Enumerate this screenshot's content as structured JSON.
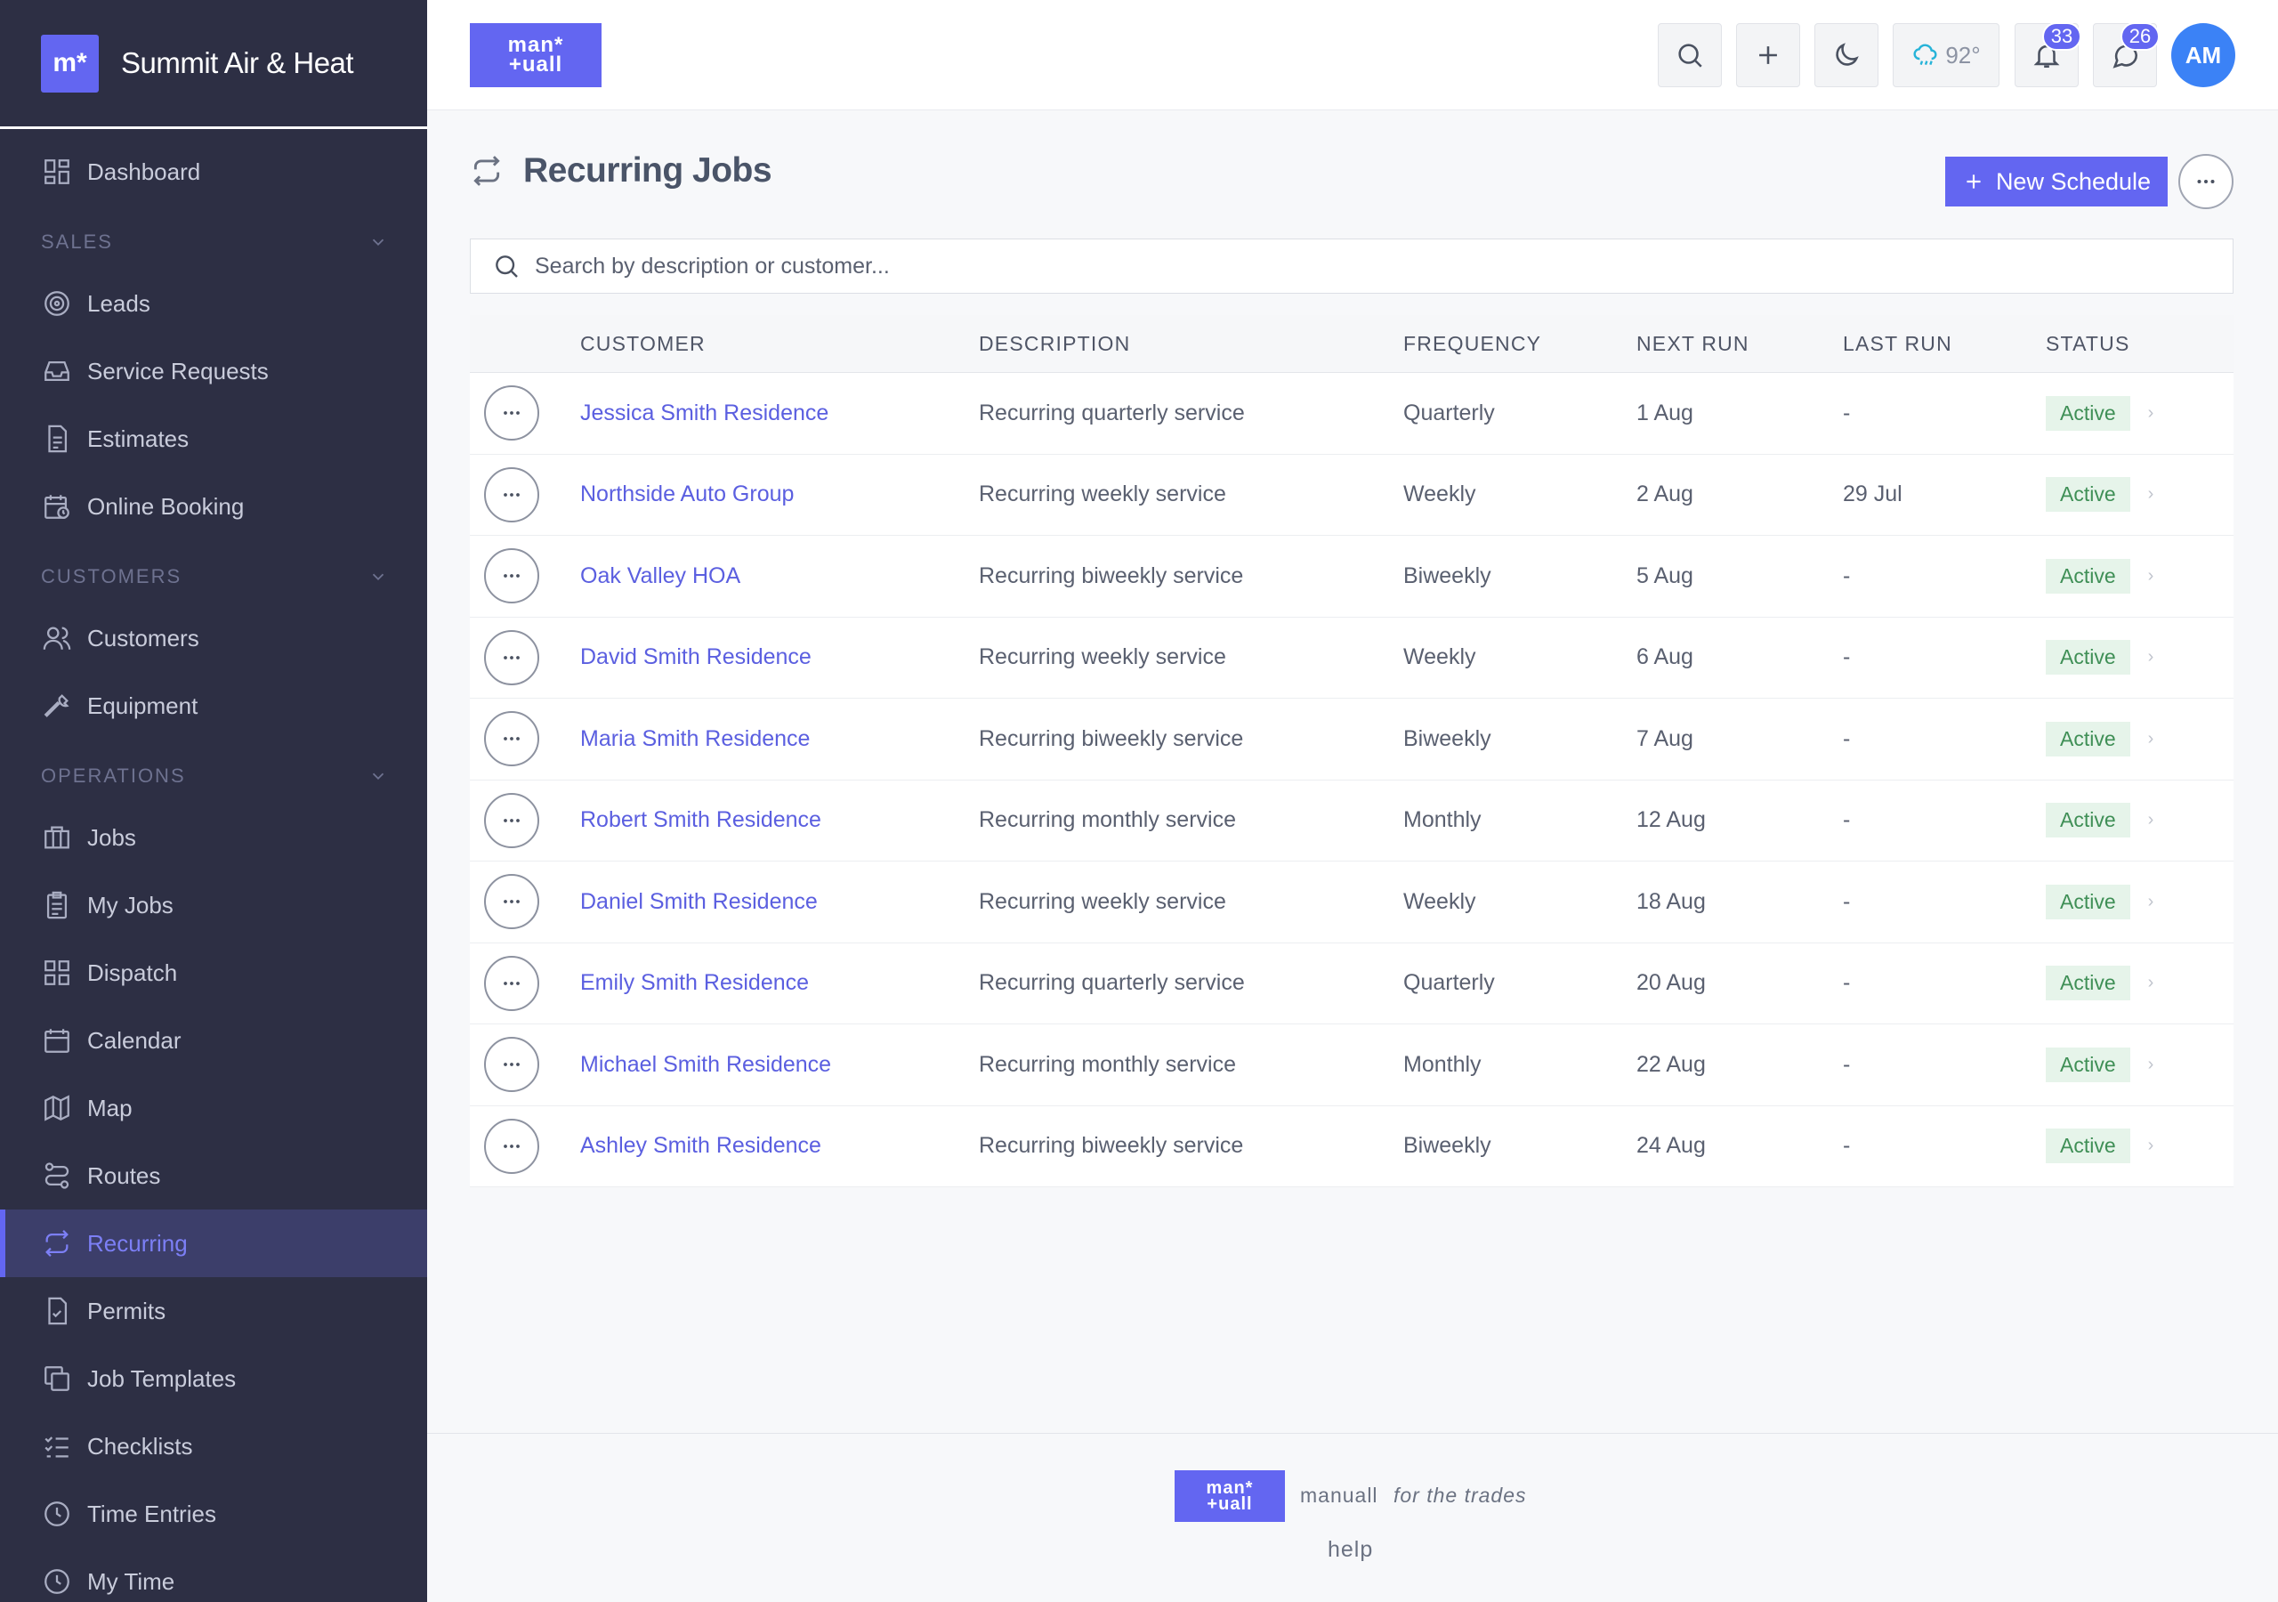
{
  "brand": {
    "mark": "m*",
    "name": "Summit Air & Heat"
  },
  "logo": {
    "line1": "man*",
    "line2": "+uall"
  },
  "sidebar": {
    "dashboard": "Dashboard",
    "sections": [
      {
        "label": "SALES",
        "items": [
          "Leads",
          "Service Requests",
          "Estimates",
          "Online Booking"
        ]
      },
      {
        "label": "CUSTOMERS",
        "items": [
          "Customers",
          "Equipment"
        ]
      },
      {
        "label": "OPERATIONS",
        "items": [
          "Jobs",
          "My Jobs",
          "Dispatch",
          "Calendar",
          "Map",
          "Routes",
          "Recurring",
          "Permits",
          "Job Templates",
          "Checklists",
          "Time Entries",
          "My Time"
        ]
      }
    ],
    "active": "Recurring"
  },
  "header": {
    "weather_temp": "92°",
    "notifications_count": "33",
    "messages_count": "26",
    "avatar_initials": "AM"
  },
  "page": {
    "title": "Recurring Jobs",
    "new_button": "New Schedule",
    "search_placeholder": "Search by description or customer..."
  },
  "table": {
    "columns": [
      "CUSTOMER",
      "DESCRIPTION",
      "FREQUENCY",
      "NEXT RUN",
      "LAST RUN",
      "STATUS"
    ],
    "rows": [
      {
        "customer": "Jessica Smith Residence",
        "description": "Recurring quarterly service",
        "frequency": "Quarterly",
        "next_run": "1 Aug",
        "last_run": "-",
        "status": "Active"
      },
      {
        "customer": "Northside Auto Group",
        "description": "Recurring weekly service",
        "frequency": "Weekly",
        "next_run": "2 Aug",
        "last_run": "29 Jul",
        "status": "Active"
      },
      {
        "customer": "Oak Valley HOA",
        "description": "Recurring biweekly service",
        "frequency": "Biweekly",
        "next_run": "5 Aug",
        "last_run": "-",
        "status": "Active"
      },
      {
        "customer": "David Smith Residence",
        "description": "Recurring weekly service",
        "frequency": "Weekly",
        "next_run": "6 Aug",
        "last_run": "-",
        "status": "Active"
      },
      {
        "customer": "Maria Smith Residence",
        "description": "Recurring biweekly service",
        "frequency": "Biweekly",
        "next_run": "7 Aug",
        "last_run": "-",
        "status": "Active"
      },
      {
        "customer": "Robert Smith Residence",
        "description": "Recurring monthly service",
        "frequency": "Monthly",
        "next_run": "12 Aug",
        "last_run": "-",
        "status": "Active"
      },
      {
        "customer": "Daniel Smith Residence",
        "description": "Recurring weekly service",
        "frequency": "Weekly",
        "next_run": "18 Aug",
        "last_run": "-",
        "status": "Active"
      },
      {
        "customer": "Emily Smith Residence",
        "description": "Recurring quarterly service",
        "frequency": "Quarterly",
        "next_run": "20 Aug",
        "last_run": "-",
        "status": "Active"
      },
      {
        "customer": "Michael Smith Residence",
        "description": "Recurring monthly service",
        "frequency": "Monthly",
        "next_run": "22 Aug",
        "last_run": "-",
        "status": "Active"
      },
      {
        "customer": "Ashley Smith Residence",
        "description": "Recurring biweekly service",
        "frequency": "Biweekly",
        "next_run": "24 Aug",
        "last_run": "-",
        "status": "Active"
      }
    ]
  },
  "footer": {
    "name": "manuall",
    "tagline": "for the trades",
    "help": "help"
  },
  "colors": {
    "accent": "#6366f1",
    "sidebar_bg": "#2d2f44",
    "status_bg": "#e6f4ea",
    "status_text": "#3f8f56"
  }
}
